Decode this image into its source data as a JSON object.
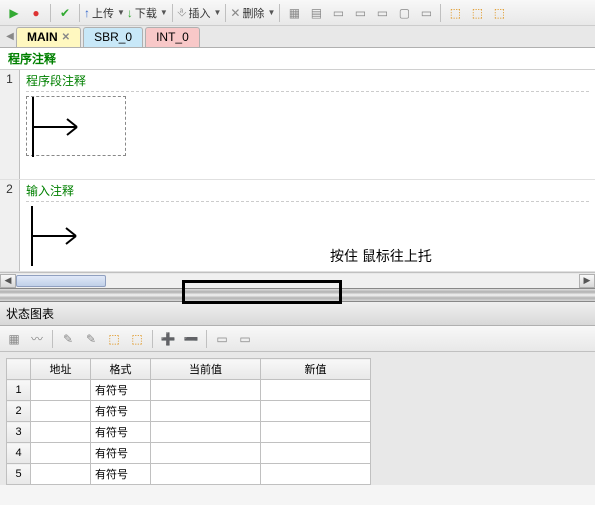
{
  "toolbar": {
    "upload_label": "上传",
    "download_label": "下载",
    "insert_label": "插入",
    "delete_label": "删除"
  },
  "tabs": [
    {
      "label": "MAIN",
      "active": true,
      "closable": true
    },
    {
      "label": "SBR_0",
      "kind": "sbr"
    },
    {
      "label": "INT_0",
      "kind": "int"
    }
  ],
  "editor": {
    "program_comment": "程序注释",
    "rungs": [
      {
        "num": "1",
        "comment": "程序段注释"
      },
      {
        "num": "2",
        "comment": "输入注释"
      }
    ]
  },
  "annotation": "按住 鼠标往上托",
  "status_panel": {
    "title": "状态图表",
    "columns": [
      "地址",
      "格式",
      "当前值",
      "新值"
    ],
    "rows": [
      {
        "n": "1",
        "addr": "",
        "fmt": "有符号",
        "cur": "",
        "nv": ""
      },
      {
        "n": "2",
        "addr": "",
        "fmt": "有符号",
        "cur": "",
        "nv": ""
      },
      {
        "n": "3",
        "addr": "",
        "fmt": "有符号",
        "cur": "",
        "nv": ""
      },
      {
        "n": "4",
        "addr": "",
        "fmt": "有符号",
        "cur": "",
        "nv": ""
      },
      {
        "n": "5",
        "addr": "",
        "fmt": "有符号",
        "cur": "",
        "nv": ""
      }
    ]
  }
}
